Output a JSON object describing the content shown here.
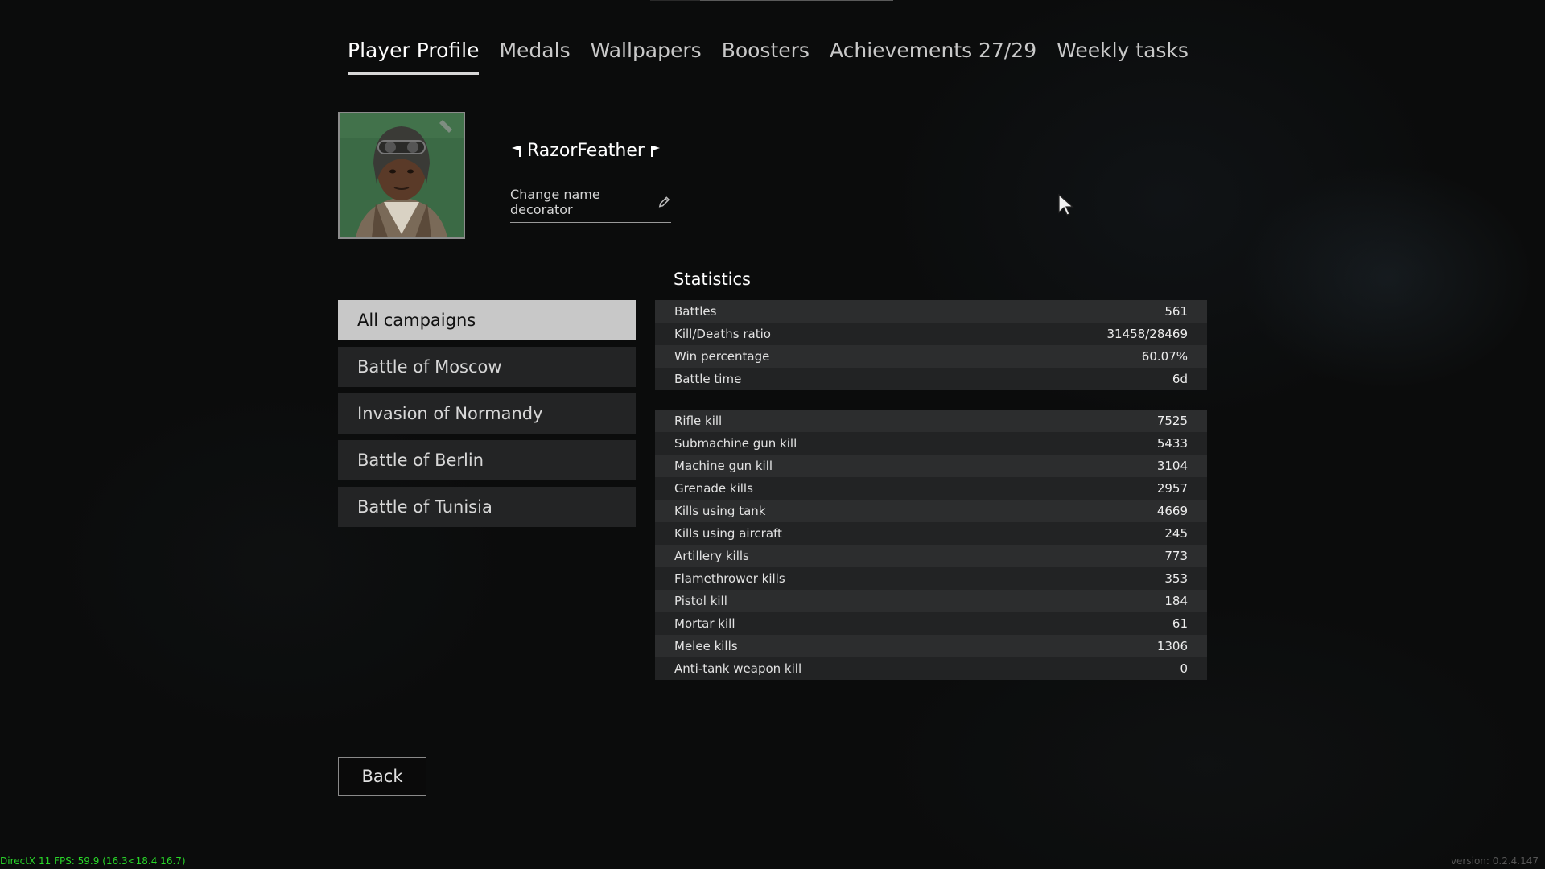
{
  "tabs": [
    {
      "label": "Player Profile",
      "active": true
    },
    {
      "label": "Medals",
      "active": false
    },
    {
      "label": "Wallpapers",
      "active": false
    },
    {
      "label": "Boosters",
      "active": false
    },
    {
      "label": "Achievements 27/29",
      "active": false
    },
    {
      "label": "Weekly tasks",
      "active": false
    }
  ],
  "profile": {
    "player_name": "RazorFeather",
    "name_decorator_icon": "flag-icon",
    "change_decorator_label": "Change name decorator",
    "change_decorator_icon": "pencil-icon"
  },
  "campaigns": [
    {
      "label": "All campaigns",
      "active": true
    },
    {
      "label": "Battle of Moscow",
      "active": false
    },
    {
      "label": "Invasion of Normandy",
      "active": false
    },
    {
      "label": "Battle of Berlin",
      "active": false
    },
    {
      "label": "Battle of Tunisia",
      "active": false
    }
  ],
  "statistics": {
    "title": "Statistics",
    "summary": [
      {
        "label": "Battles",
        "value": "561"
      },
      {
        "label": "Kill/Deaths ratio",
        "value": "31458/28469"
      },
      {
        "label": "Win percentage",
        "value": "60.07%"
      },
      {
        "label": "Battle time",
        "value": "6d"
      }
    ],
    "kills": [
      {
        "label": "Rifle kill",
        "value": "7525"
      },
      {
        "label": "Submachine gun kill",
        "value": "5433"
      },
      {
        "label": "Machine gun kill",
        "value": "3104"
      },
      {
        "label": "Grenade kills",
        "value": "2957"
      },
      {
        "label": "Kills using tank",
        "value": "4669"
      },
      {
        "label": "Kills using aircraft",
        "value": "245"
      },
      {
        "label": "Artillery kills",
        "value": "773"
      },
      {
        "label": "Flamethrower kills",
        "value": "353"
      },
      {
        "label": "Pistol kill",
        "value": "184"
      },
      {
        "label": "Mortar kill",
        "value": "61"
      },
      {
        "label": "Melee kills",
        "value": "1306"
      },
      {
        "label": "Anti-tank weapon kill",
        "value": "0"
      }
    ]
  },
  "back_label": "Back",
  "footer": {
    "fps_text": "DirectX 11 FPS: 59.9 (16.3<18.4 16.7)",
    "version_text": "version: 0.2.4.147"
  }
}
